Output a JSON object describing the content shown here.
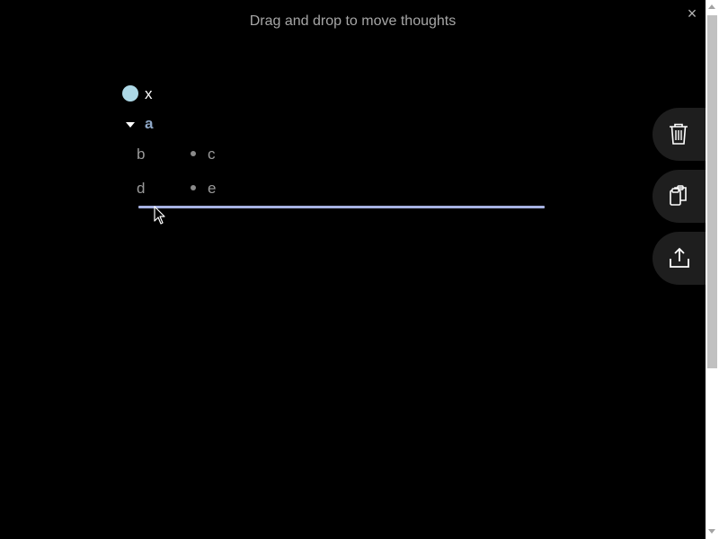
{
  "header": {
    "hint": "Drag and drop to move thoughts",
    "close_symbol": "×"
  },
  "thoughts": {
    "root": {
      "label": "x"
    },
    "parent": {
      "label": "a"
    },
    "children": [
      {
        "left": "b",
        "right": "c"
      },
      {
        "left": "d",
        "right": "e"
      }
    ]
  },
  "actions": [
    {
      "name": "delete",
      "icon": "trash-icon"
    },
    {
      "name": "copy",
      "icon": "clipboard-copy-icon"
    },
    {
      "name": "export",
      "icon": "share-export-icon"
    }
  ],
  "colors": {
    "background": "#000000",
    "root_bullet": "#add8e6",
    "parent_text": "#8fa8c8",
    "drop_indicator": "#a6b1e1",
    "side_button_bg": "#1e1e1e"
  }
}
